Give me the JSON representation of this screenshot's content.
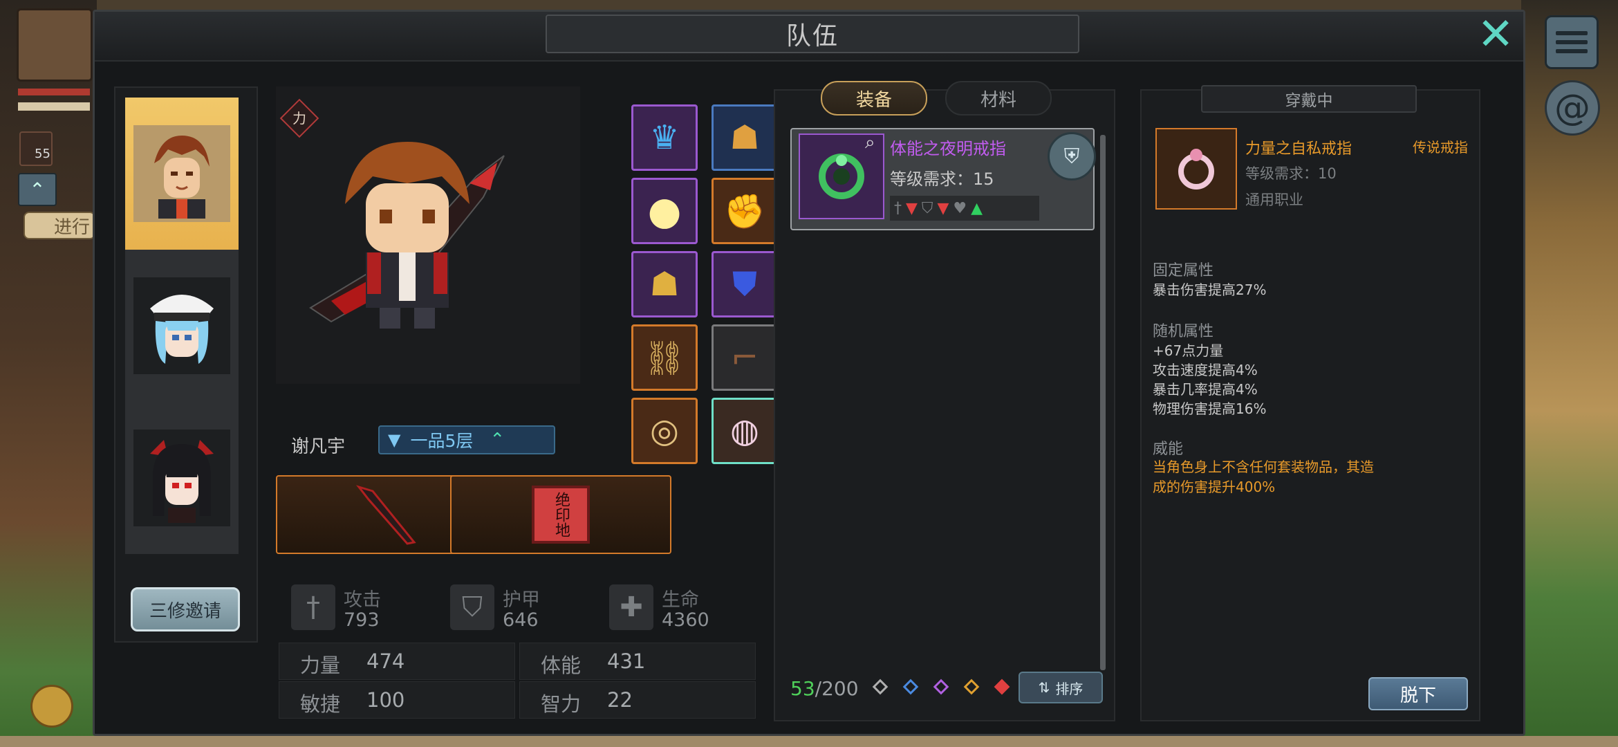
{
  "window": {
    "title": "队伍"
  },
  "background_hud": {
    "item_count": "55",
    "progress_label": "进行",
    "icons": [
      "menu-icon",
      "swirl-icon",
      "coin-icon",
      "up-arrow-icon"
    ]
  },
  "hero_list": {
    "heroes": [
      {
        "name": "hero-1",
        "active": true
      },
      {
        "name": "hero-2",
        "active": false
      },
      {
        "name": "hero-3",
        "active": false
      }
    ],
    "invite_label": "三修邀请"
  },
  "character": {
    "tag": "力",
    "name": "谢凡宇",
    "rank": "一品5层"
  },
  "equipment_slots": [
    {
      "rarity": "purple",
      "icon": "helmet-icon"
    },
    {
      "rarity": "blue",
      "icon": "mask-icon"
    },
    {
      "rarity": "purple",
      "icon": "orb-icon"
    },
    {
      "rarity": "orange",
      "icon": "gauntlet-icon"
    },
    {
      "rarity": "purple",
      "icon": "chest-armor-icon"
    },
    {
      "rarity": "purple",
      "icon": "blue-armor-icon"
    },
    {
      "rarity": "orange",
      "icon": "belt-icon"
    },
    {
      "rarity": "gray",
      "icon": "boot-icon"
    },
    {
      "rarity": "orange",
      "icon": "amulet-ring-icon"
    },
    {
      "rarity": "selected",
      "icon": "ring-icon"
    }
  ],
  "special_slots": [
    {
      "icon": "dark-blade-icon"
    },
    {
      "icon": "seal-icon",
      "seal_text": "绝印地"
    }
  ],
  "stats": {
    "attack": {
      "label": "攻击",
      "value": "793"
    },
    "armor": {
      "label": "护甲",
      "value": "646"
    },
    "health": {
      "label": "生命",
      "value": "4360"
    }
  },
  "attributes": [
    {
      "label": "力量",
      "value": "474"
    },
    {
      "label": "体能",
      "value": "431"
    },
    {
      "label": "敏捷",
      "value": "100"
    },
    {
      "label": "智力",
      "value": "22"
    }
  ],
  "inventory": {
    "tab_equipment": "装备",
    "tab_materials": "材料",
    "item": {
      "name": "体能之夜明戒指",
      "requirement": "等级需求：15"
    },
    "count_current": "53",
    "count_max": "/200",
    "sort_label": "排序",
    "rarity_filters": [
      "#b0b0b0",
      "#4a8ae0",
      "#b060e0",
      "#e0a030",
      "#e04040"
    ]
  },
  "detail": {
    "header": "穿戴中",
    "item_name": "力量之自私戒指",
    "item_type": "传说戒指",
    "requirement": "等级需求：10",
    "job": "通用职业",
    "fixed_title": "固定属性",
    "fixed_lines": [
      "暴击伤害提高27%"
    ],
    "random_title": "随机属性",
    "random_lines": [
      "+67点力量",
      "攻击速度提高4%",
      "暴击几率提高4%",
      "物理伤害提高16%"
    ],
    "power_title": "威能",
    "power_lines": [
      "当角色身上不含任何套装物品，其造",
      "成的伤害提升400%"
    ],
    "unequip_label": "脱下"
  },
  "colors": {
    "accent_teal": "#5fd7c4",
    "legendary": "#e89a2a",
    "epic": "#c25cf0",
    "active_hero": "#f1c86a"
  }
}
